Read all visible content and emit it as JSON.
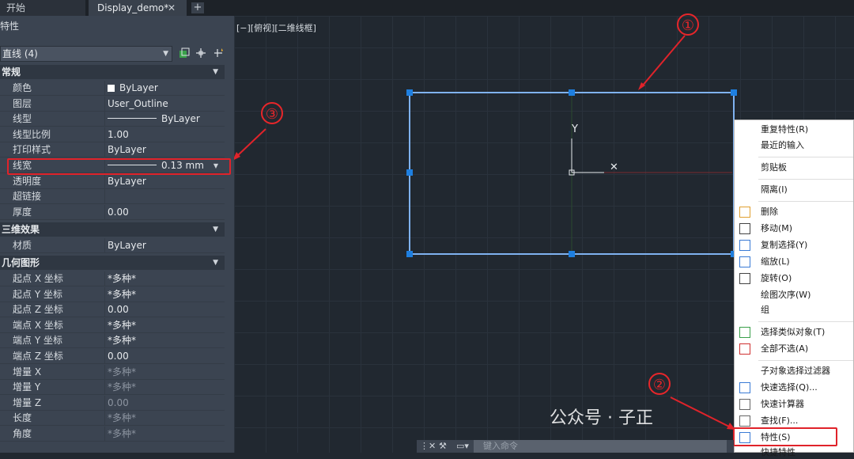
{
  "tabs": {
    "start": "开始",
    "doc": "Display_demo*",
    "close": "✕",
    "add": "+"
  },
  "panel": {
    "title": "特性",
    "object_select": "直线 (4)",
    "sections": {
      "general": "常规",
      "threed": "三维效果",
      "geometry": "几何图形"
    },
    "general_rows": [
      {
        "label": "颜色",
        "value": "ByLayer"
      },
      {
        "label": "图层",
        "value": "User_Outline"
      },
      {
        "label": "线型",
        "value": "ByLayer"
      },
      {
        "label": "线型比例",
        "value": "1.00"
      },
      {
        "label": "打印样式",
        "value": "ByLayer"
      },
      {
        "label": "线宽",
        "value": "0.13 mm"
      },
      {
        "label": "透明度",
        "value": "ByLayer"
      },
      {
        "label": "超链接",
        "value": ""
      },
      {
        "label": "厚度",
        "value": "0.00"
      }
    ],
    "threed_rows": [
      {
        "label": "材质",
        "value": "ByLayer"
      }
    ],
    "geometry_rows": [
      {
        "label": "起点 X 坐标",
        "value": "*多种*"
      },
      {
        "label": "起点 Y 坐标",
        "value": "*多种*"
      },
      {
        "label": "起点 Z 坐标",
        "value": "0.00"
      },
      {
        "label": "端点 X 坐标",
        "value": "*多种*"
      },
      {
        "label": "端点 Y 坐标",
        "value": "*多种*"
      },
      {
        "label": "端点 Z 坐标",
        "value": "0.00"
      },
      {
        "label": "增量 X",
        "value": "*多种*"
      },
      {
        "label": "增量 Y",
        "value": "*多种*"
      },
      {
        "label": "增量 Z",
        "value": "0.00"
      },
      {
        "label": "长度",
        "value": "*多种*"
      },
      {
        "label": "角度",
        "value": "*多种*"
      }
    ]
  },
  "viewport_label": "[−][俯视][二维线框]",
  "ucs": {
    "y": "Y",
    "x": "✕"
  },
  "context_menu": [
    "重复特性(R)",
    "最近的输入",
    "剪贴板",
    "隔离(I)",
    "删除",
    "移动(M)",
    "复制选择(Y)",
    "缩放(L)",
    "旋转(O)",
    "绘图次序(W)",
    "组",
    "选择类似对象(T)",
    "全部不选(A)",
    "子对象选择过滤器",
    "快速选择(Q)...",
    "快速计算器",
    "查找(F)...",
    "特性(S)",
    "快捷特性"
  ],
  "annotations": {
    "c1": "①",
    "c2": "②",
    "c3": "③"
  },
  "command": {
    "placeholder": "键入命令"
  },
  "watermark": "公众号 · 子正",
  "colors": {
    "accent_red": "#e0232a",
    "grip_blue": "#1e7fe0",
    "line_blue": "#7fb2f0"
  }
}
